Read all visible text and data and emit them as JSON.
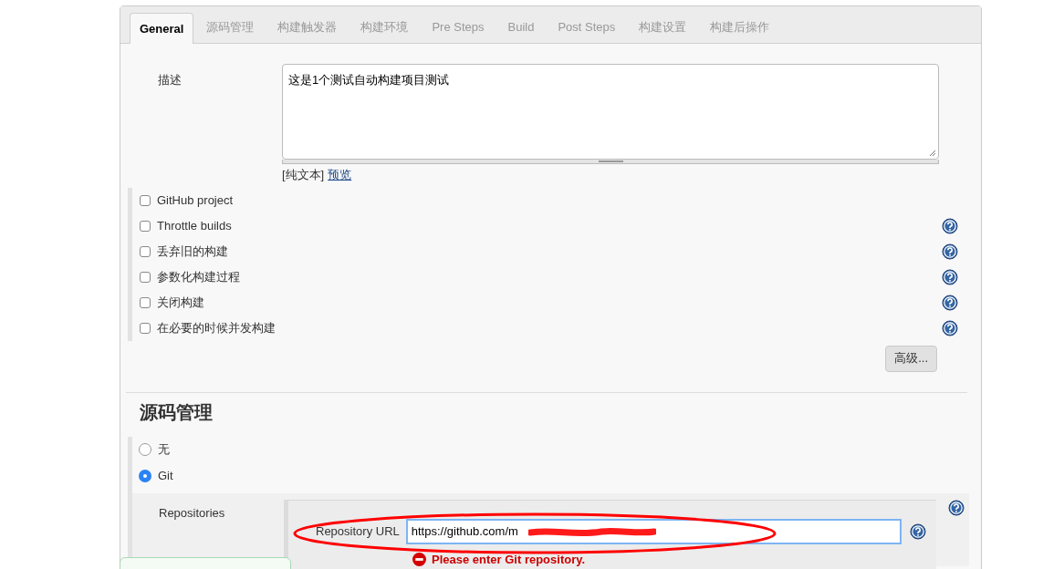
{
  "tabs": [
    {
      "label": "General",
      "selected": true
    },
    {
      "label": "源码管理",
      "selected": false
    },
    {
      "label": "构建触发器",
      "selected": false
    },
    {
      "label": "构建环境",
      "selected": false
    },
    {
      "label": "Pre Steps",
      "selected": false
    },
    {
      "label": "Build",
      "selected": false
    },
    {
      "label": "Post Steps",
      "selected": false
    },
    {
      "label": "构建设置",
      "selected": false
    },
    {
      "label": "构建后操作",
      "selected": false
    }
  ],
  "description": {
    "label": "描述",
    "value": "这是1个测试自动构建项目测试",
    "format": "[纯文本]",
    "preview_link": "预览"
  },
  "options": [
    {
      "label": "GitHub project",
      "checked": false,
      "help": false
    },
    {
      "label": "Throttle builds",
      "checked": false,
      "help": true
    },
    {
      "label": "丢弃旧的构建",
      "checked": false,
      "help": true
    },
    {
      "label": "参数化构建过程",
      "checked": false,
      "help": true
    },
    {
      "label": "关闭构建",
      "checked": false,
      "help": true
    },
    {
      "label": "在必要的时候并发构建",
      "checked": false,
      "help": true
    }
  ],
  "advanced_button": "高级...",
  "scm": {
    "heading": "源码管理",
    "choices": [
      {
        "label": "无",
        "selected": false
      },
      {
        "label": "Git",
        "selected": true
      }
    ],
    "repositories_label": "Repositories",
    "url_label": "Repository URL",
    "url_value": "https://github.com/m",
    "error": "Please enter Git repository."
  }
}
